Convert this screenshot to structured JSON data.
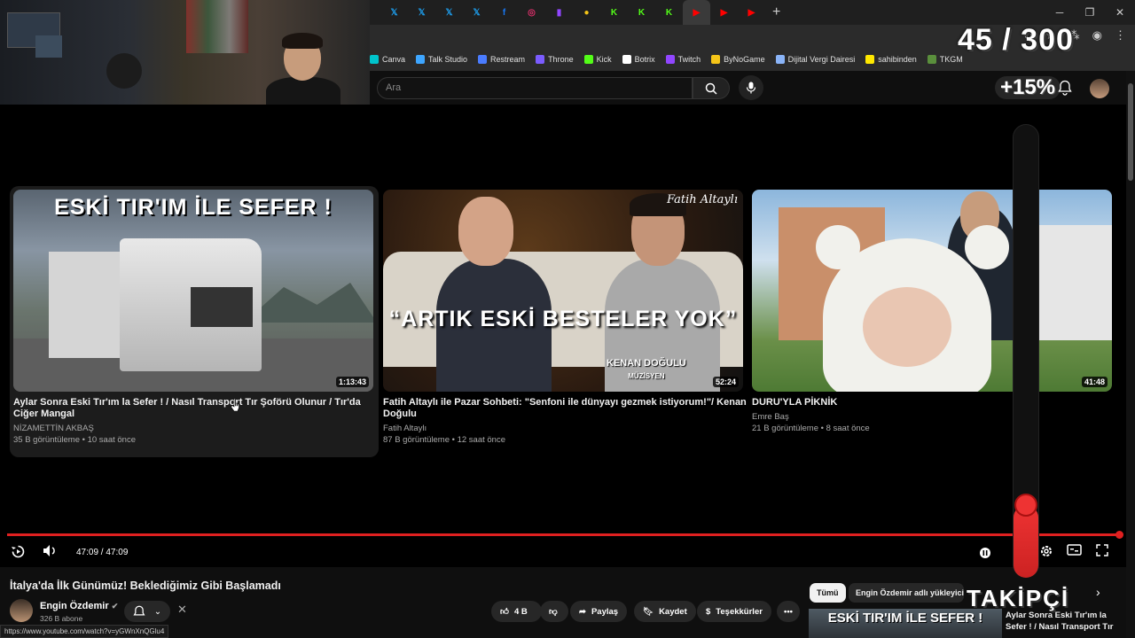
{
  "overlay": {
    "counter": "45 / 300",
    "create_text": "+15%",
    "takipci": "TAKİPÇİ",
    "vertical_progress": 0.16
  },
  "browser": {
    "tabs": [
      {
        "icon": "twitter-icon",
        "color": "#1da1f2",
        "glyph": "𝕏"
      },
      {
        "icon": "twitter-icon",
        "color": "#1da1f2",
        "glyph": "𝕏"
      },
      {
        "icon": "twitter-icon",
        "color": "#1da1f2",
        "glyph": "𝕏"
      },
      {
        "icon": "twitter-icon",
        "color": "#1da1f2",
        "glyph": "𝕏"
      },
      {
        "icon": "facebook-icon",
        "color": "#1877f2",
        "glyph": "f"
      },
      {
        "icon": "instagram-icon",
        "color": "#e1306c",
        "glyph": "◎"
      },
      {
        "icon": "twitch-icon",
        "color": "#9146ff",
        "glyph": "▮"
      },
      {
        "icon": "bynogame-icon",
        "color": "#f5c518",
        "glyph": "●"
      },
      {
        "icon": "kick-icon",
        "color": "#53fc18",
        "glyph": "K"
      },
      {
        "icon": "kick-icon",
        "color": "#53fc18",
        "glyph": "K"
      },
      {
        "icon": "kick-icon",
        "color": "#53fc18",
        "glyph": "K"
      },
      {
        "icon": "youtube-icon",
        "color": "#ff0000",
        "glyph": "▶",
        "active": true
      },
      {
        "icon": "youtube-icon",
        "color": "#ff0000",
        "glyph": "▶"
      },
      {
        "icon": "youtube-icon",
        "color": "#ff0000",
        "glyph": "▶"
      }
    ],
    "new_tab": "+",
    "bookmarks": [
      {
        "label": "Canva",
        "icon": "canva-icon",
        "color": "#00c4cc"
      },
      {
        "label": "Talk Studio",
        "icon": "talk-studio-icon",
        "color": "#3ea6ff"
      },
      {
        "label": "Restream",
        "icon": "restream-icon",
        "color": "#4a7cff"
      },
      {
        "label": "Throne",
        "icon": "throne-icon",
        "color": "#7b5cff"
      },
      {
        "label": "Kick",
        "icon": "kick-icon",
        "color": "#53fc18"
      },
      {
        "label": "Botrix",
        "icon": "botrix-icon",
        "color": "#ffffff"
      },
      {
        "label": "Twitch",
        "icon": "twitch-icon",
        "color": "#9146ff"
      },
      {
        "label": "ByNoGame",
        "icon": "bynogame-icon",
        "color": "#f5c518"
      },
      {
        "label": "Dijital Vergi Dairesi",
        "icon": "vergi-icon",
        "color": "#8ab4f8"
      },
      {
        "label": "sahibinden",
        "icon": "sahibinden-icon",
        "color": "#ffe800"
      },
      {
        "label": "TKGM",
        "icon": "tkgm-icon",
        "color": "#5a8f3c"
      }
    ]
  },
  "youtube": {
    "search_placeholder": "Ara"
  },
  "videos": [
    {
      "title": "Aylar Sonra Eski Tır'ım la Sefer ! / Nasıl Transport Tır Şoförü Olunur / Tır'da Ciğer Mangal",
      "channel": "NİZAMETTİN AKBAŞ",
      "meta": "35 B görüntüleme • 10 saat önce",
      "duration": "1:13:43",
      "thumb_text": "ESKİ TIR'IM İLE SEFER !"
    },
    {
      "title": "Fatih Altaylı ile Pazar Sohbeti: \"Senfoni ile dünyayı gezmek istiyorum!\"/ Kenan Doğulu",
      "channel": "Fatih Altaylı",
      "meta": "87 B görüntüleme • 12 saat önce",
      "duration": "52:24",
      "thumb_text": "“ARTIK ESKİ BESTELER YOK”",
      "thumb_name": "KENAN DOĞULU",
      "thumb_role": "MÜZİSYEN",
      "thumb_signature": "Fatih Altaylı"
    },
    {
      "title": "DURU'YLA PİKNİK",
      "channel": "Emre Baş",
      "meta": "21 B görüntüleme • 8 saat önce",
      "duration": "41:48"
    }
  ],
  "player": {
    "time": "47:09 / 47:09",
    "progress": 1.0
  },
  "watch": {
    "title": "İtalya'da İlk Günümüz! Beklediğimiz Gibi Başlamadı",
    "channel": "Engin Özdemir",
    "subscribers": "326 B abone",
    "likes": "4 B",
    "share": "Paylaş",
    "save": "Kaydet",
    "thanks": "Teşekkürler",
    "chips": [
      "Tümü",
      "Engin Özdemir adlı yükleyicide"
    ],
    "next_thumb_text": "ESKİ TIR'IM İLE SEFER !",
    "next_title": "Aylar Sonra Eski Tır'ım la Sefer ! / Nasıl Transport Tır ..."
  },
  "status_url": "https://www.youtube.com/watch?v=yGWnXnQGlu4"
}
